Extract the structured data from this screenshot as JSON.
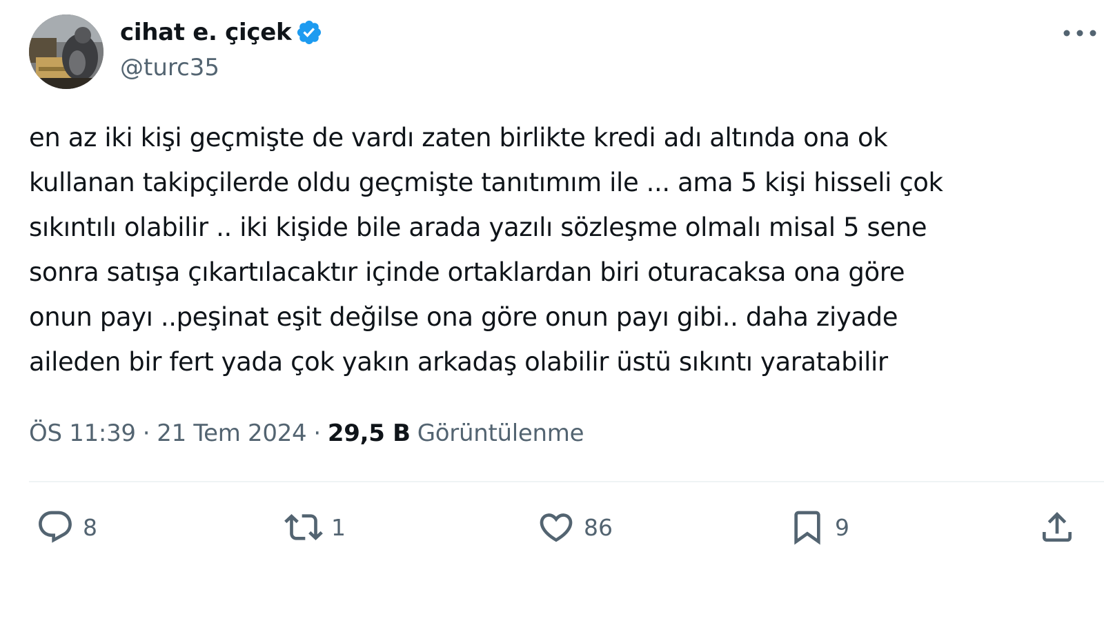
{
  "author": {
    "display_name": "cihat e. çiçek",
    "handle": "@turc35",
    "verified": true,
    "avatar_icon": "profile-photo",
    "verified_color": "#1d9bf0"
  },
  "menu": {
    "icon": "more-horizontal-icon"
  },
  "tweet": {
    "text": "en az iki kişi geçmişte de vardı zaten birlikte kredi adı altında ona ok\nkullanan takipçilerde oldu geçmişte tanıtımım ile ... ama 5 kişi hisseli çok\nsıkıntılı olabilir .. iki kişide bile arada yazılı sözleşme olmalı misal 5 sene\nsonra satışa çıkartılacaktır içinde ortaklardan biri oturacaksa ona göre\nonun payı ..peşinat eşit değilse ona göre onun payı gibi.. daha ziyade\naileden bir fert yada çok yakın arkadaş olabilir üstü sıkıntı yaratabilir"
  },
  "meta": {
    "time": "ÖS 11:39",
    "separator": "·",
    "date": "21 Tem 2024",
    "views_count": "29,5 B",
    "views_label": "Görüntülenme"
  },
  "actions": {
    "reply": {
      "icon": "reply-icon",
      "count": "8"
    },
    "retweet": {
      "icon": "retweet-icon",
      "count": "1"
    },
    "like": {
      "icon": "heart-icon",
      "count": "86"
    },
    "bookmark": {
      "icon": "bookmark-icon",
      "count": "9"
    },
    "share": {
      "icon": "share-icon"
    }
  },
  "colors": {
    "text_primary": "#0f1419",
    "text_secondary": "#536471",
    "divider": "#eff3f4"
  }
}
